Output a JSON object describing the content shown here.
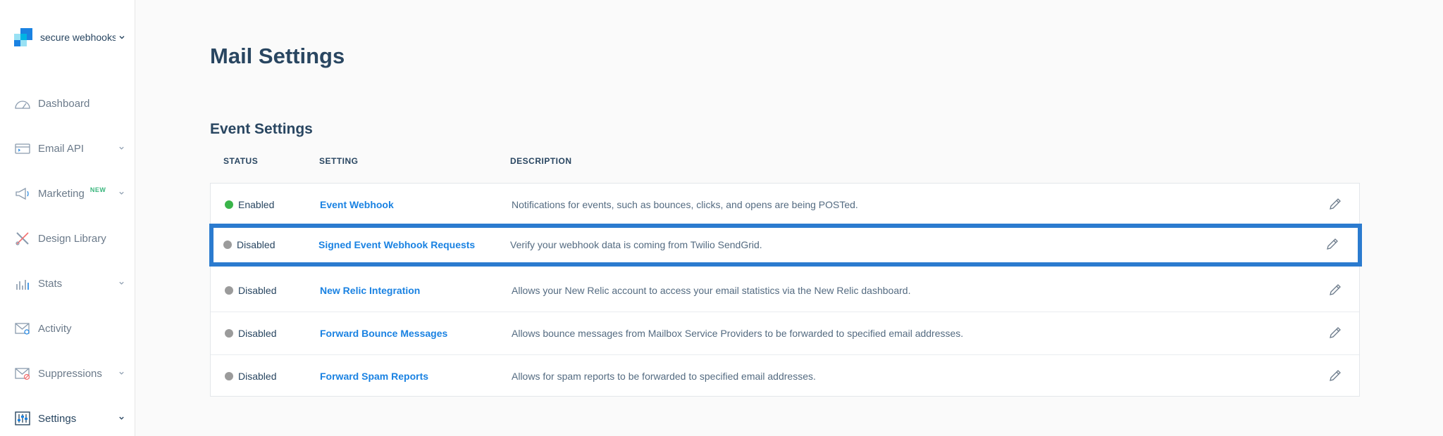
{
  "sidebar": {
    "account_name": "secure webhookstest",
    "items": [
      {
        "label": "Dashboard",
        "icon": "dashboard-gauge-icon",
        "badge": "",
        "chevron": false
      },
      {
        "label": "Email API",
        "icon": "email-api-icon",
        "badge": "",
        "chevron": true
      },
      {
        "label": "Marketing",
        "icon": "megaphone-icon",
        "badge": "NEW",
        "chevron": true
      },
      {
        "label": "Design Library",
        "icon": "design-tools-icon",
        "badge": "",
        "chevron": false
      },
      {
        "label": "Stats",
        "icon": "stats-bars-icon",
        "badge": "",
        "chevron": true
      },
      {
        "label": "Activity",
        "icon": "activity-mail-icon",
        "badge": "",
        "chevron": false
      },
      {
        "label": "Suppressions",
        "icon": "suppressions-mail-icon",
        "badge": "",
        "chevron": true
      },
      {
        "label": "Settings",
        "icon": "settings-sliders-icon",
        "badge": "",
        "chevron": true
      }
    ]
  },
  "main": {
    "title": "Mail Settings",
    "section_title": "Event Settings",
    "columns": [
      "STATUS",
      "SETTING",
      "DESCRIPTION"
    ],
    "rows": [
      {
        "status": "Enabled",
        "setting": "Event Webhook",
        "description": "Notifications for events, such as bounces, clicks, and opens are being POSTed."
      },
      {
        "status": "Disabled",
        "setting": "Signed Event Webhook Requests",
        "description": "Verify your webhook data is coming from Twilio SendGrid."
      },
      {
        "status": "Disabled",
        "setting": "New Relic Integration",
        "description": "Allows your New Relic account to access your email statistics via the New Relic dashboard."
      },
      {
        "status": "Disabled",
        "setting": "Forward Bounce Messages",
        "description": "Allows bounce messages from Mailbox Service Providers to be forwarded to specified email addresses."
      },
      {
        "status": "Disabled",
        "setting": "Forward Spam Reports",
        "description": "Allows for spam reports to be forwarded to specified email addresses."
      }
    ]
  },
  "colors": {
    "enabled": "#3ab54a",
    "disabled": "#9b9b9b",
    "link": "#1a82e2",
    "highlight": "#2b7bcf",
    "heading": "#294661"
  }
}
